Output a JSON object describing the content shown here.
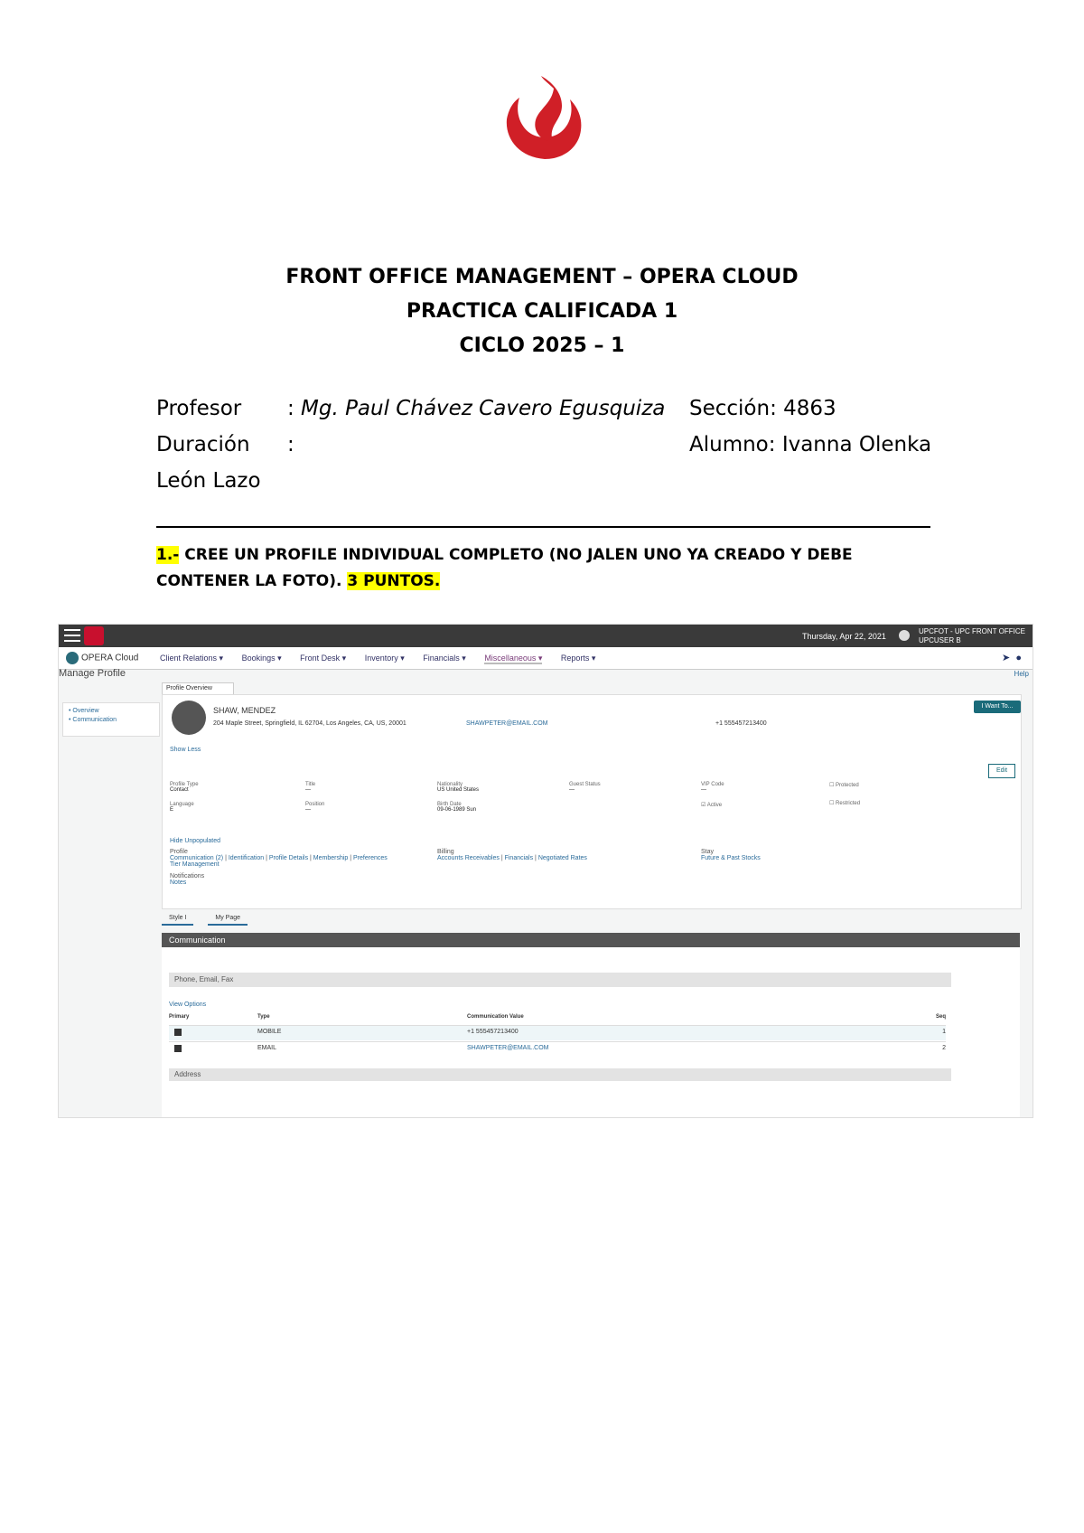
{
  "header": {
    "logo": "upc-flame-logo",
    "title_line1": "FRONT OFFICE MANAGEMENT – OPERA CLOUD",
    "title_line2": "PRACTICA CALIFICADA 1",
    "title_line3": "CICLO 2025 – 1"
  },
  "meta": {
    "profesor_label": "Profesor",
    "profesor_colon": ":",
    "profesor_value": "Mg. Paul Chávez Cavero Egusquiza",
    "seccion": "Sección: 4863",
    "duracion_label": "Duración",
    "duracion_colon": ":",
    "alumno": "Alumno: Ivanna Olenka",
    "alumno_cont": "León Lazo"
  },
  "question": {
    "number": "1.-",
    "text": " CREE UN PROFILE INDIVIDUAL COMPLETO (NO JALEN UNO YA CREADO Y DEBE CONTENER LA FOTO). ",
    "points": "3 PUNTOS."
  },
  "screenshot": {
    "top_date": "Thursday, Apr 22, 2021",
    "top_user_line1": "UPCFOT - UPC FRONT OFFICE",
    "top_user_line2": "UPCUSER B",
    "brand": "OPERA Cloud",
    "nav": [
      "Client Relations ▾",
      "Bookings ▾",
      "Front Desk ▾",
      "Inventory ▾",
      "Financials ▾",
      "Miscellaneous ▾",
      "Reports ▾"
    ],
    "page_title": "Manage Profile",
    "help": "Help",
    "side_overview": "• Overview",
    "side_comm": "• Communication",
    "tab_overview": "Profile Overview",
    "profile_name": "SHAW, MENDEZ",
    "profile_address": "204 Maple Street, Springfield, IL 62704, Los Angeles, CA, US, 20001",
    "profile_email": "SHAWPETER@EMAIL.COM",
    "profile_phone": "+1 555457213400",
    "iweb": "I Want To...",
    "show_less": "Show Less",
    "edit": "Edit",
    "f_profile_type_l": "Profile Type",
    "f_profile_type_v": "Contact",
    "f_language_l": "Language",
    "f_language_v": "E",
    "f_title_l": "Title",
    "f_title_v": "—",
    "f_position_l": "Position",
    "f_position_v": "—",
    "f_nationality_l": "Nationality",
    "f_nationality_v": "US  United States",
    "f_birthdate_l": "Birth Date",
    "f_birthdate_v": "09-06-1989  Sun",
    "f_guest_l": "Guest Status",
    "f_guest_v": "—",
    "f_vip_l": "VIP Code",
    "f_vip_v": "—",
    "f_active": "Active",
    "f_protected": "Protected",
    "f_restricted": "Restricted",
    "hide_links": "Hide Unpopulated",
    "g_profile": "Profile",
    "l_comm": "Communication (2)",
    "l_ident": "Identification",
    "l_details": "Profile Details",
    "l_member": "Membership",
    "l_pref": "Preferences",
    "l_tier": "Tier Management",
    "g_notif": "Notifications",
    "l_notes": "Notes",
    "g_billing": "Billing",
    "l_ar": "Accounts Receivables",
    "l_fin": "Financials",
    "l_neg": "Negotiated Rates",
    "g_stay": "Stay",
    "l_future": "Future & Past Stocks",
    "tab_style": "Style I",
    "tab_mypage": "My Page",
    "comm_title": "Communication",
    "pef": "Phone, Email, Fax",
    "view_options": "View Options",
    "th_primary": "Primary",
    "th_type": "Type",
    "th_value": "Communication Value",
    "th_seq": "Seq",
    "rows": [
      {
        "type": "MOBILE",
        "value": "+1 555457213400",
        "seq": "1"
      },
      {
        "type": "EMAIL",
        "value": "SHAWPETER@EMAIL.COM",
        "seq": "2"
      }
    ],
    "address_bar": "Address"
  }
}
